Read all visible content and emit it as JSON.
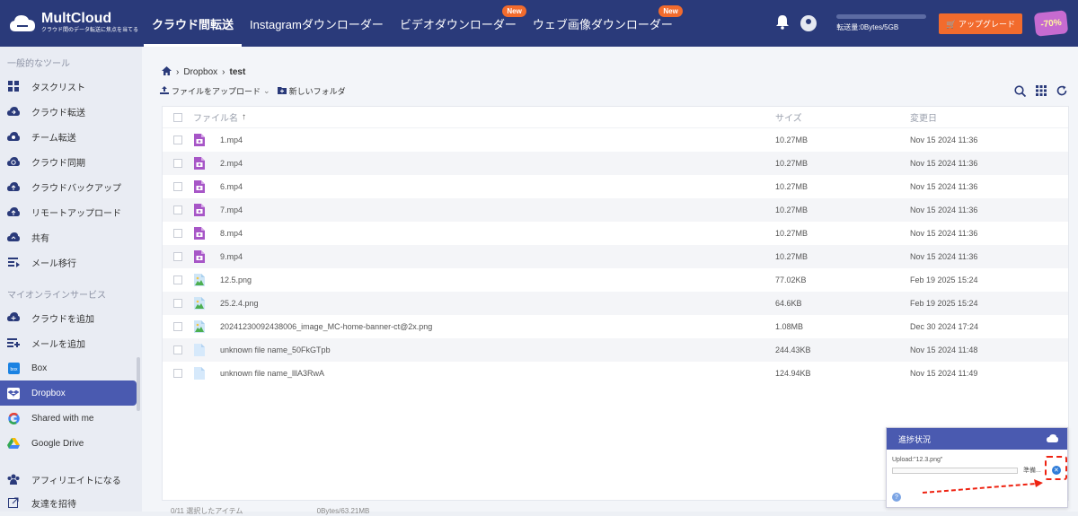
{
  "app": {
    "name": "MultCloud",
    "tagline": "クラウド間のデータ転送に焦点を当てる"
  },
  "nav": {
    "items": [
      {
        "label": "クラウド間転送"
      },
      {
        "label": "Instagramダウンローダー"
      },
      {
        "label": "ビデオダウンローダー",
        "badge": "New"
      },
      {
        "label": "ウェブ画像ダウンローダー",
        "badge": "New"
      }
    ]
  },
  "header": {
    "quota_text": "転送量:0Bytes/5GB",
    "upgrade_label": "アップグレード",
    "promo_text": "-70%"
  },
  "sidebar": {
    "section_tools": "一般的なツール",
    "tools": [
      {
        "label": "タスクリスト",
        "icon": "grid-icon"
      },
      {
        "label": "クラウド転送",
        "icon": "cloud-transfer-icon"
      },
      {
        "label": "チーム転送",
        "icon": "team-transfer-icon"
      },
      {
        "label": "クラウド同期",
        "icon": "cloud-sync-icon"
      },
      {
        "label": "クラウドバックアップ",
        "icon": "cloud-backup-icon"
      },
      {
        "label": "リモートアップロード",
        "icon": "remote-upload-icon"
      },
      {
        "label": "共有",
        "icon": "share-icon"
      },
      {
        "label": "メール移行",
        "icon": "email-migration-icon"
      }
    ],
    "section_services": "マイオンラインサービス",
    "services": [
      {
        "label": "クラウドを追加",
        "icon": "add-cloud-icon"
      },
      {
        "label": "メールを追加",
        "icon": "add-email-icon"
      },
      {
        "label": "Box",
        "icon": "box-icon"
      },
      {
        "label": "Dropbox",
        "icon": "dropbox-icon"
      },
      {
        "label": "Shared with me",
        "icon": "google-icon"
      },
      {
        "label": "Google Drive",
        "icon": "google-drive-icon"
      }
    ],
    "bottom": [
      {
        "label": "アフィリエイトになる",
        "icon": "affiliate-icon"
      },
      {
        "label": "友達を招待",
        "icon": "invite-icon"
      }
    ]
  },
  "breadcrumb": {
    "root": "Dropbox",
    "current": "test"
  },
  "toolbar": {
    "upload_label": "ファイルをアップロード",
    "new_folder_label": "新しいフォルダ"
  },
  "table": {
    "headers": {
      "name": "ファイル名",
      "size": "サイズ",
      "date": "変更日"
    },
    "rows": [
      {
        "name": "1.mp4",
        "size": "10.27MB",
        "date": "Nov 15 2024 11:36",
        "type": "video"
      },
      {
        "name": "2.mp4",
        "size": "10.27MB",
        "date": "Nov 15 2024 11:36",
        "type": "video"
      },
      {
        "name": "6.mp4",
        "size": "10.27MB",
        "date": "Nov 15 2024 11:36",
        "type": "video"
      },
      {
        "name": "7.mp4",
        "size": "10.27MB",
        "date": "Nov 15 2024 11:36",
        "type": "video"
      },
      {
        "name": "8.mp4",
        "size": "10.27MB",
        "date": "Nov 15 2024 11:36",
        "type": "video"
      },
      {
        "name": "9.mp4",
        "size": "10.27MB",
        "date": "Nov 15 2024 11:36",
        "type": "video"
      },
      {
        "name": "12.5.png",
        "size": "77.02KB",
        "date": "Feb 19 2025 15:24",
        "type": "image"
      },
      {
        "name": "25.2.4.png",
        "size": "64.6KB",
        "date": "Feb 19 2025 15:24",
        "type": "image"
      },
      {
        "name": "20241230092438006_image_MC-home-banner-ct@2x.png",
        "size": "1.08MB",
        "date": "Dec 30 2024 17:24",
        "type": "image"
      },
      {
        "name": "unknown file name_50FkGTpb",
        "size": "244.43KB",
        "date": "Nov 15 2024 11:48",
        "type": "file"
      },
      {
        "name": "unknown file name_lllA3RwA",
        "size": "124.94KB",
        "date": "Nov 15 2024 11:49",
        "type": "file"
      }
    ]
  },
  "footer": {
    "selected": "0/11 選択したアイテム",
    "total": "0Bytes/63.21MB"
  },
  "progress": {
    "title": "進捗状況",
    "file": "Upload:\"12.3.png\"",
    "status": "準備...",
    "fraction": 0
  },
  "colors": {
    "header_bg": "#2a3a7a",
    "accent": "#4a5ab0",
    "upgrade": "#f26b2d",
    "highlight": "#e21111"
  }
}
